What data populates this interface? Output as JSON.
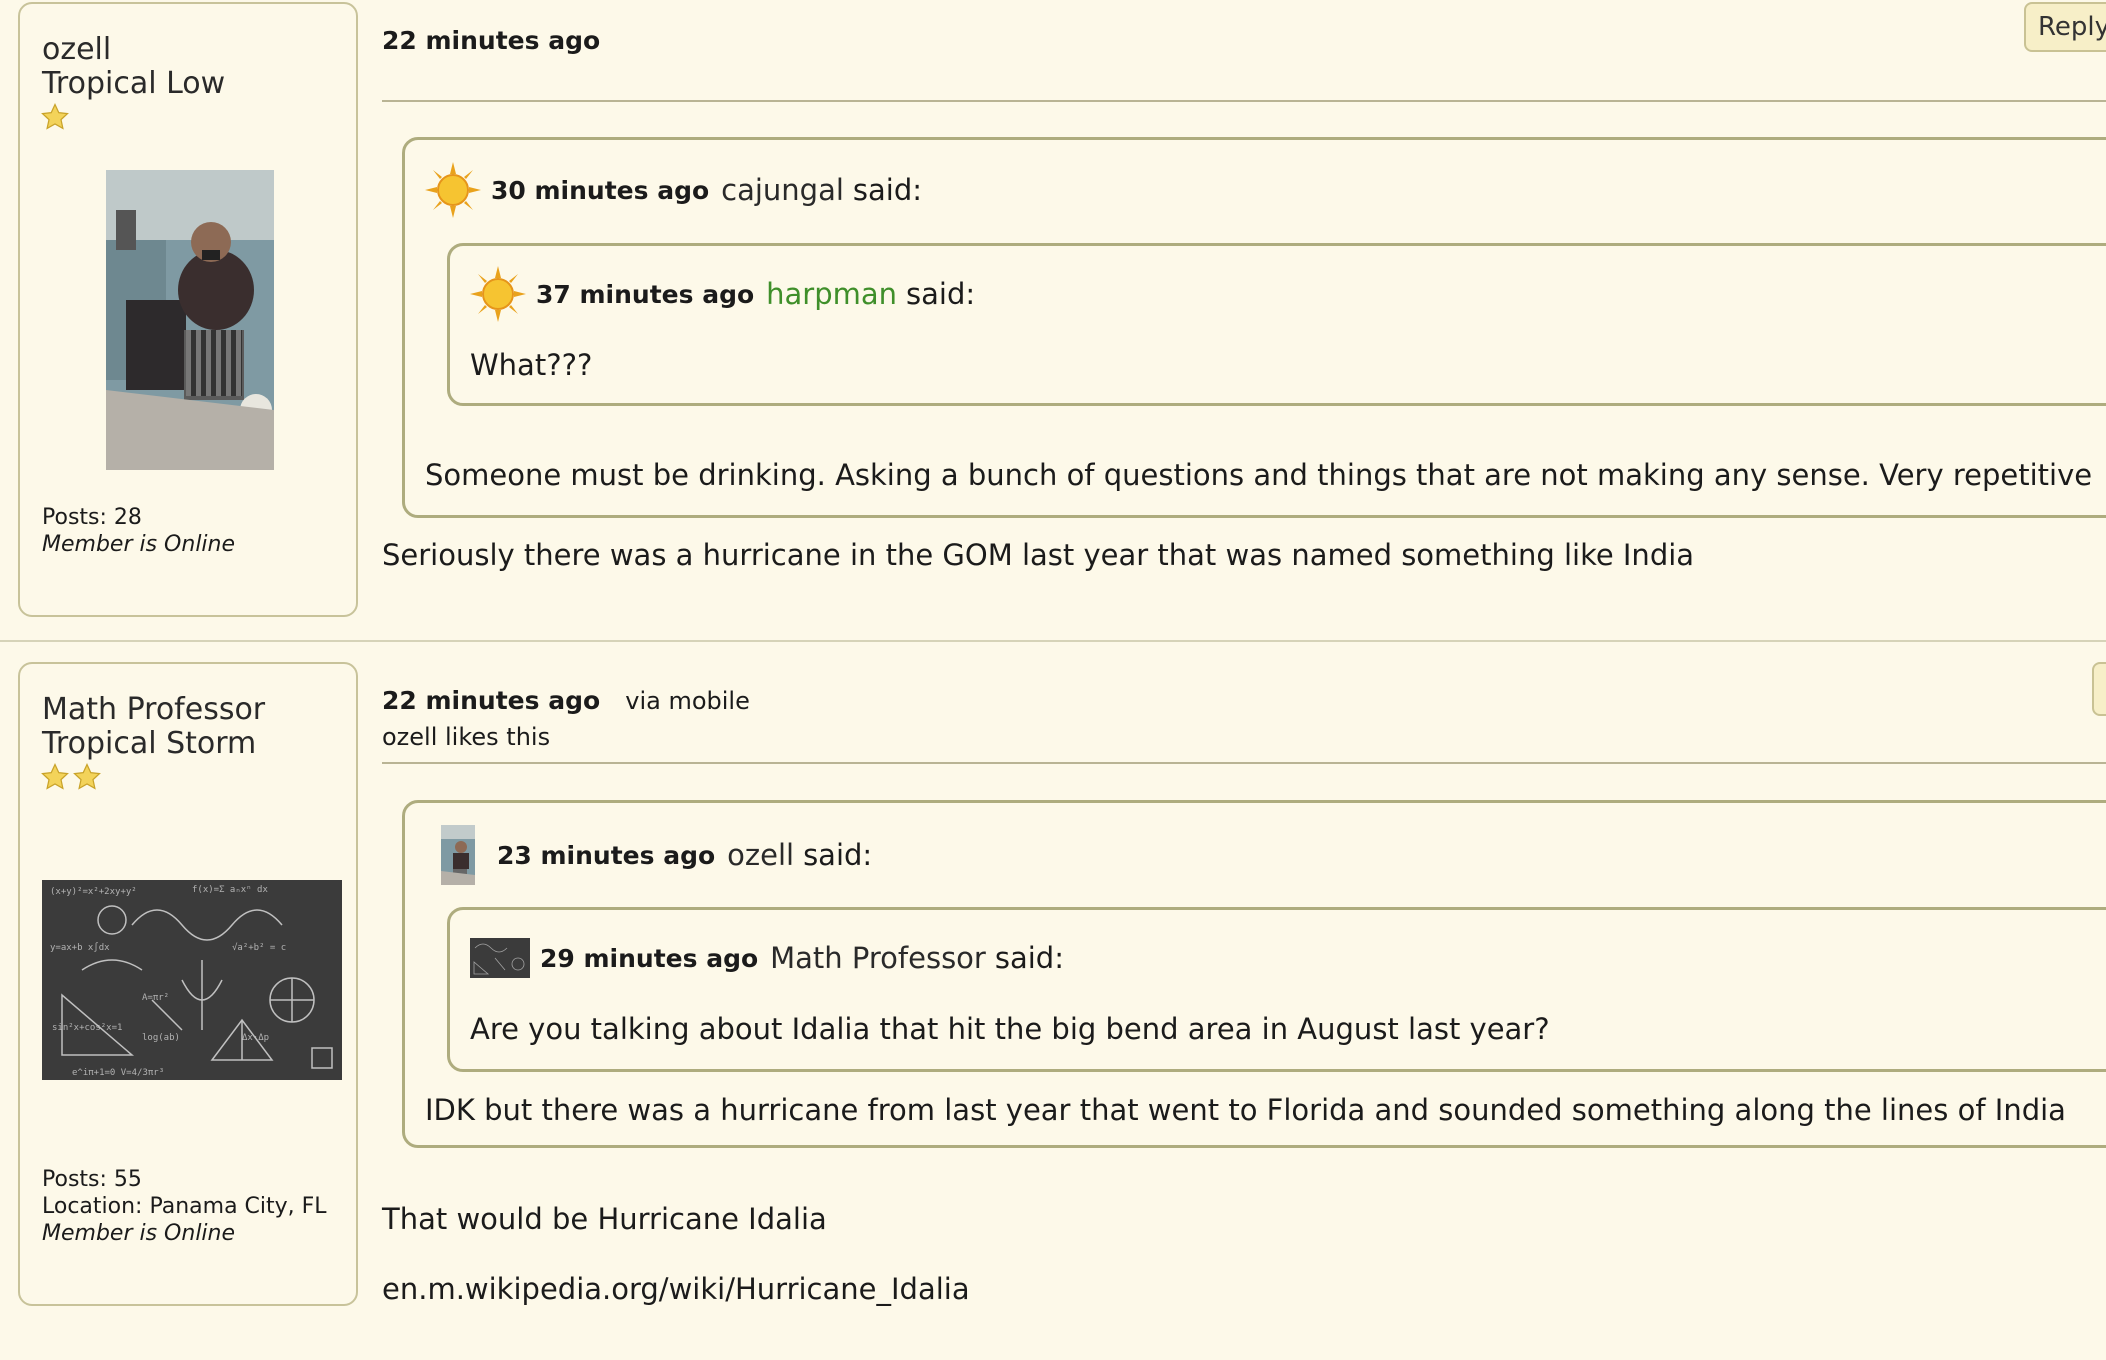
{
  "posts": [
    {
      "author": {
        "name": "ozell",
        "rank": "Tropical Low",
        "posts": "Posts: 28",
        "status": "Member is Online"
      },
      "time": "22 minutes ago",
      "reply_label": "Reply",
      "quote": {
        "time": "30 minutes ago",
        "author": "cajungal",
        "said": "said:",
        "inner": {
          "time": "37 minutes ago",
          "author": "harpman",
          "said": "said:",
          "text": "What???"
        },
        "text": "Someone must be drinking. Asking a bunch of questions and things that are not making any sense. Very repetitive"
      },
      "text": "Seriously there was a hurricane in the GOM last year that was named something like India"
    },
    {
      "author": {
        "name": "Math Professor",
        "rank": "Tropical Storm",
        "posts": "Posts: 55",
        "location": "Location: Panama City, FL",
        "status": "Member is Online"
      },
      "time": "22 minutes ago",
      "via": "via mobile",
      "likes": "ozell likes this",
      "quote": {
        "time": "23 minutes ago",
        "author": "ozell",
        "said": "said:",
        "inner": {
          "time": "29 minutes ago",
          "author": "Math Professor",
          "said": "said:",
          "text": "Are you talking about Idalia that hit the big bend area in August last year?"
        },
        "text": "IDK but there was a hurricane from last year that went to Florida and sounded something along the lines of India"
      },
      "text": "That would be Hurricane Idalia",
      "link": "en.m.wikipedia.org/wiki/Hurricane_Idalia"
    }
  ],
  "colors": {
    "background": "#fdf9e9",
    "border": "#aeac7e",
    "green_user": "#3f8f2a",
    "star": "#f3d35a"
  },
  "icons": [
    "star-icon",
    "sun-icon",
    "avatar-thumbnail"
  ]
}
